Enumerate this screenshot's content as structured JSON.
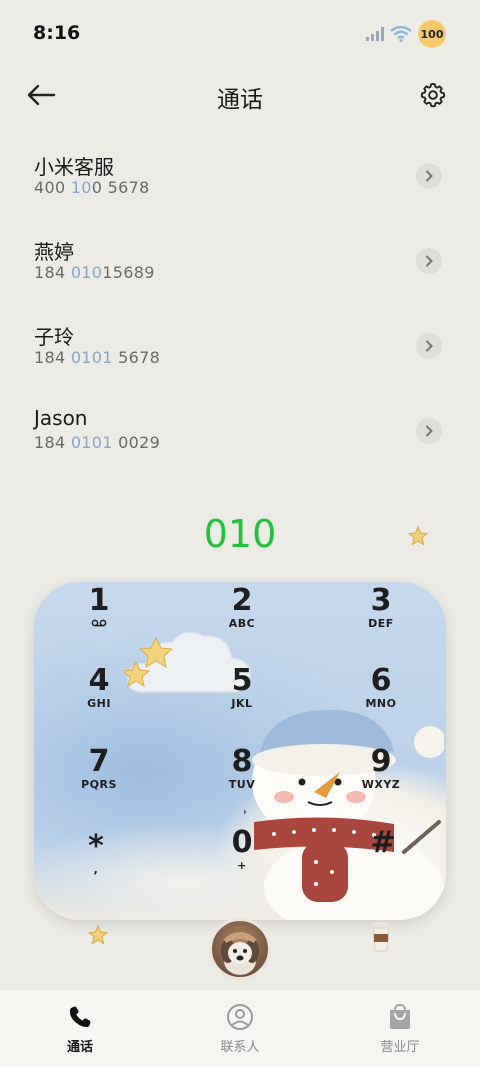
{
  "status": {
    "time": "8:16",
    "battery": "100"
  },
  "header": {
    "title": "通话"
  },
  "contacts": [
    {
      "name": "小米客服",
      "num_a": "400 ",
      "num_hl": "10",
      "num_b": "0 5678"
    },
    {
      "name": "燕婷",
      "num_a": "184 ",
      "num_hl": "010",
      "num_b": "15689"
    },
    {
      "name": "子玲",
      "num_a": "184 ",
      "num_hl": "0101",
      "num_b": " 5678"
    },
    {
      "name": "Jason",
      "num_a": "184 ",
      "num_hl": "0101",
      "num_b": " 0029"
    }
  ],
  "dial": {
    "input": "010"
  },
  "keys": [
    {
      "digit": "1",
      "letters": ""
    },
    {
      "digit": "2",
      "letters": "ABC"
    },
    {
      "digit": "3",
      "letters": "DEF"
    },
    {
      "digit": "4",
      "letters": "GHI"
    },
    {
      "digit": "5",
      "letters": "JKL"
    },
    {
      "digit": "6",
      "letters": "MNO"
    },
    {
      "digit": "7",
      "letters": "PQRS"
    },
    {
      "digit": "8",
      "letters": "TUV"
    },
    {
      "digit": "9",
      "letters": "WXYZ"
    },
    {
      "digit": "*",
      "letters": ","
    },
    {
      "digit": "0",
      "letters": "+"
    },
    {
      "digit": "#",
      "letters": ""
    }
  ],
  "nav": {
    "calls": "通话",
    "contacts": "联系人",
    "service": "营业厅"
  },
  "icons": {
    "back": "arrow-left-icon",
    "settings": "gear-icon",
    "chevron": "chevron-right-icon",
    "voicemail": "voicemail-icon"
  },
  "colors": {
    "dial_accent": "#1fc43b",
    "number_highlight": "#8ba5c4"
  }
}
